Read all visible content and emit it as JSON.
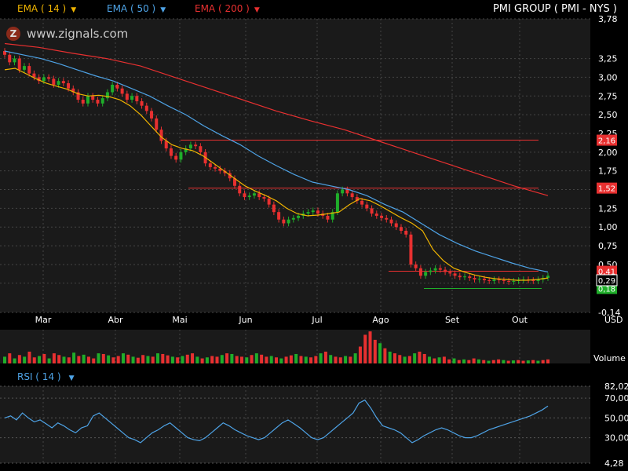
{
  "header": {
    "title": "PMI GROUP  ( PMI - NYS )",
    "indicators": [
      {
        "label": "EMA ( 14 )",
        "color": "#f0b400"
      },
      {
        "label": "EMA ( 50 )",
        "color": "#4ea3e6"
      },
      {
        "label": "EMA ( 200 )",
        "color": "#e83030"
      }
    ]
  },
  "watermark": {
    "icon": "zignals-logo-icon",
    "text": "www.zignals.com"
  },
  "chart_data": [
    {
      "type": "candlestick",
      "price_axis": {
        "ticks": [
          "3,78",
          "3,25",
          "3,00",
          "2,75",
          "2,50",
          "2,25",
          "2,00",
          "1,75",
          "1,50",
          "1,25",
          "1,00",
          "0,75",
          "0,50",
          "0,25",
          "-0,14"
        ],
        "ylim": [
          -0.14,
          3.78
        ],
        "unit": "USD"
      },
      "months": [
        "Mar",
        "Abr",
        "Mai",
        "Jun",
        "Jul",
        "Ago",
        "Set",
        "Out"
      ],
      "closes": [
        3.3,
        3.2,
        3.25,
        3.1,
        3.15,
        3.05,
        3.0,
        2.95,
        3.0,
        2.98,
        2.9,
        2.95,
        2.92,
        2.85,
        2.8,
        2.7,
        2.65,
        2.75,
        2.7,
        2.65,
        2.72,
        2.8,
        2.9,
        2.85,
        2.78,
        2.7,
        2.75,
        2.68,
        2.62,
        2.55,
        2.45,
        2.3,
        2.15,
        2.05,
        1.95,
        1.9,
        2.0,
        2.05,
        2.1,
        2.08,
        2.0,
        1.85,
        1.8,
        1.78,
        1.75,
        1.72,
        1.65,
        1.55,
        1.45,
        1.4,
        1.42,
        1.45,
        1.4,
        1.38,
        1.3,
        1.2,
        1.1,
        1.05,
        1.1,
        1.12,
        1.15,
        1.18,
        1.2,
        1.22,
        1.18,
        1.15,
        1.1,
        1.2,
        1.45,
        1.5,
        1.45,
        1.4,
        1.35,
        1.3,
        1.25,
        1.18,
        1.15,
        1.12,
        1.1,
        1.05,
        1.0,
        0.95,
        0.9,
        0.5,
        0.45,
        0.35,
        0.4,
        0.42,
        0.45,
        0.43,
        0.4,
        0.38,
        0.35,
        0.33,
        0.34,
        0.32,
        0.3,
        0.31,
        0.29,
        0.28,
        0.3,
        0.29,
        0.28,
        0.27,
        0.28,
        0.29,
        0.3,
        0.29,
        0.28,
        0.3,
        0.32,
        0.35
      ],
      "ema_14": [
        3.1,
        3.12,
        3.05,
        2.98,
        2.92,
        2.88,
        2.84,
        2.78,
        2.75,
        2.76,
        2.74,
        2.7,
        2.62,
        2.5,
        2.35,
        2.2,
        2.1,
        2.05,
        2.02,
        1.95,
        1.85,
        1.75,
        1.65,
        1.55,
        1.48,
        1.42,
        1.35,
        1.25,
        1.18,
        1.15,
        1.16,
        1.18,
        1.2,
        1.3,
        1.38,
        1.35,
        1.28,
        1.2,
        1.12,
        1.05,
        0.95,
        0.7,
        0.55,
        0.45,
        0.4,
        0.36,
        0.33,
        0.31,
        0.3,
        0.29,
        0.29,
        0.3,
        0.32
      ],
      "ema_50": [
        3.35,
        3.3,
        3.25,
        3.18,
        3.1,
        3.02,
        2.95,
        2.85,
        2.75,
        2.62,
        2.5,
        2.35,
        2.22,
        2.1,
        1.95,
        1.82,
        1.7,
        1.6,
        1.55,
        1.5,
        1.42,
        1.3,
        1.2,
        1.05,
        0.9,
        0.78,
        0.68,
        0.6,
        0.52,
        0.45,
        0.4
      ],
      "ema_200": [
        3.45,
        3.4,
        3.32,
        3.25,
        3.15,
        3.0,
        2.85,
        2.7,
        2.55,
        2.42,
        2.3,
        2.15,
        2.0,
        1.85,
        1.7,
        1.55,
        1.42
      ],
      "levels": [
        {
          "label": "2,16",
          "value": 2.16
        },
        {
          "label": "1,52",
          "value": 1.52
        },
        {
          "label": "0,41",
          "value": 0.41
        },
        {
          "label": "0,18",
          "value": 0.18
        }
      ],
      "last_price": {
        "label": "0,29",
        "value": 0.29
      }
    },
    {
      "type": "bar",
      "title": "Volume",
      "values": [
        0.2,
        0.3,
        0.15,
        0.25,
        0.2,
        0.35,
        0.18,
        0.22,
        0.28,
        0.15,
        0.3,
        0.25,
        0.2,
        0.18,
        0.32,
        0.22,
        0.26,
        0.2,
        0.15,
        0.3,
        0.28,
        0.24,
        0.18,
        0.22,
        0.3,
        0.26,
        0.2,
        0.17,
        0.25,
        0.22,
        0.2,
        0.3,
        0.28,
        0.24,
        0.2,
        0.18,
        0.22,
        0.26,
        0.3,
        0.2,
        0.15,
        0.18,
        0.22,
        0.2,
        0.25,
        0.3,
        0.28,
        0.22,
        0.2,
        0.18,
        0.25,
        0.3,
        0.26,
        0.2,
        0.22,
        0.18,
        0.15,
        0.2,
        0.24,
        0.28,
        0.22,
        0.2,
        0.18,
        0.22,
        0.3,
        0.35,
        0.25,
        0.2,
        0.18,
        0.22,
        0.2,
        0.3,
        0.5,
        0.85,
        0.95,
        0.7,
        0.6,
        0.45,
        0.35,
        0.3,
        0.25,
        0.2,
        0.22,
        0.3,
        0.35,
        0.28,
        0.2,
        0.15,
        0.18,
        0.2,
        0.12,
        0.15,
        0.1,
        0.12,
        0.1,
        0.15,
        0.12,
        0.1,
        0.08,
        0.1,
        0.12,
        0.1,
        0.08,
        0.09,
        0.1,
        0.08,
        0.09,
        0.1,
        0.08,
        0.1,
        0.12
      ],
      "colors": [
        "g",
        "r",
        "g",
        "r",
        "g",
        "r",
        "r",
        "g",
        "r",
        "g",
        "r",
        "r",
        "g",
        "r",
        "g",
        "r",
        "g",
        "r",
        "r",
        "g",
        "r",
        "g",
        "r",
        "r",
        "g",
        "r",
        "g",
        "r",
        "r",
        "g",
        "r",
        "g",
        "r",
        "r",
        "g",
        "r",
        "g",
        "r",
        "r",
        "g",
        "r",
        "g",
        "r",
        "r",
        "g",
        "r",
        "g",
        "r",
        "r",
        "g",
        "r",
        "g",
        "r",
        "r",
        "g",
        "r",
        "g",
        "r",
        "r",
        "g",
        "r",
        "g",
        "r",
        "r",
        "g",
        "r",
        "g",
        "r",
        "r",
        "g",
        "r",
        "g",
        "r",
        "r",
        "r",
        "r",
        "g",
        "r",
        "g",
        "r",
        "r",
        "g",
        "r",
        "g",
        "r",
        "r",
        "g",
        "r",
        "g",
        "r",
        "r",
        "g",
        "r",
        "g",
        "r",
        "r",
        "g",
        "r",
        "g",
        "r",
        "r",
        "g",
        "r",
        "g",
        "r",
        "r",
        "g",
        "r",
        "g",
        "r",
        "r"
      ]
    },
    {
      "type": "line",
      "title": "RSI ( 14 )",
      "axis_ticks": [
        "82,02",
        "70,00",
        "50,00",
        "30,00",
        "4,28"
      ],
      "ylim": [
        4.28,
        82.02
      ],
      "values": [
        50,
        52,
        48,
        55,
        50,
        46,
        48,
        44,
        40,
        45,
        42,
        38,
        35,
        40,
        42,
        52,
        55,
        50,
        45,
        40,
        35,
        30,
        28,
        25,
        30,
        35,
        38,
        42,
        45,
        40,
        35,
        30,
        28,
        27,
        30,
        35,
        40,
        45,
        42,
        38,
        35,
        32,
        30,
        28,
        30,
        35,
        40,
        45,
        48,
        44,
        40,
        35,
        30,
        28,
        30,
        35,
        40,
        45,
        50,
        55,
        65,
        68,
        60,
        50,
        42,
        40,
        38,
        35,
        30,
        25,
        28,
        32,
        35,
        38,
        40,
        38,
        35,
        32,
        30,
        30,
        32,
        35,
        38,
        40,
        42,
        44,
        46,
        48,
        50,
        52,
        55,
        58,
        62
      ]
    },
    {
      "type": "axis",
      "unit": "USD",
      "volume_label": "Volume"
    }
  ]
}
